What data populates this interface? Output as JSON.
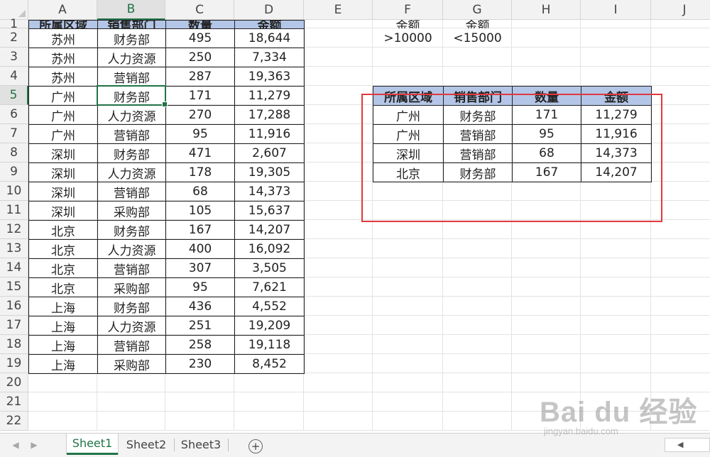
{
  "columns": [
    "A",
    "B",
    "C",
    "D",
    "E",
    "F",
    "G",
    "H",
    "I",
    "J"
  ],
  "rows": [
    "1",
    "2",
    "3",
    "4",
    "5",
    "6",
    "7",
    "8",
    "9",
    "10",
    "11",
    "12",
    "13",
    "14",
    "15",
    "16",
    "17",
    "18",
    "19",
    "20",
    "21",
    "22"
  ],
  "source_table": {
    "headers": [
      "所属区域",
      "销售部门",
      "数量",
      "金额"
    ],
    "rows": [
      [
        "苏州",
        "财务部",
        "495",
        "18,644"
      ],
      [
        "苏州",
        "人力资源",
        "250",
        "7,334"
      ],
      [
        "苏州",
        "营销部",
        "287",
        "19,363"
      ],
      [
        "广州",
        "财务部",
        "171",
        "11,279"
      ],
      [
        "广州",
        "人力资源",
        "270",
        "17,288"
      ],
      [
        "广州",
        "营销部",
        "95",
        "11,916"
      ],
      [
        "深圳",
        "财务部",
        "471",
        "2,607"
      ],
      [
        "深圳",
        "人力资源",
        "178",
        "19,305"
      ],
      [
        "深圳",
        "营销部",
        "68",
        "14,373"
      ],
      [
        "深圳",
        "采购部",
        "105",
        "15,637"
      ],
      [
        "北京",
        "财务部",
        "167",
        "14,207"
      ],
      [
        "北京",
        "人力资源",
        "400",
        "16,092"
      ],
      [
        "北京",
        "营销部",
        "307",
        "3,505"
      ],
      [
        "北京",
        "采购部",
        "95",
        "7,621"
      ],
      [
        "上海",
        "财务部",
        "436",
        "4,552"
      ],
      [
        "上海",
        "人力资源",
        "251",
        "19,209"
      ],
      [
        "上海",
        "营销部",
        "258",
        "19,118"
      ],
      [
        "上海",
        "采购部",
        "230",
        "8,452"
      ]
    ]
  },
  "criteria": {
    "headers": [
      "金额",
      "金额"
    ],
    "values": [
      ">10000",
      "<15000"
    ]
  },
  "result_table": {
    "headers": [
      "所属区域",
      "销售部门",
      "数量",
      "金额"
    ],
    "rows": [
      [
        "广州",
        "财务部",
        "171",
        "11,279"
      ],
      [
        "广州",
        "营销部",
        "95",
        "11,916"
      ],
      [
        "深圳",
        "营销部",
        "68",
        "14,373"
      ],
      [
        "北京",
        "财务部",
        "167",
        "14,207"
      ]
    ]
  },
  "active_cell": {
    "column": "B",
    "row": "5"
  },
  "sheet_tabs": [
    {
      "label": "Sheet1",
      "active": true
    },
    {
      "label": "Sheet2",
      "active": false
    },
    {
      "label": "Sheet3",
      "active": false
    }
  ],
  "add_sheet_symbol": "+",
  "nav_symbols": {
    "prev": "◀",
    "next": "▶",
    "scroll_left": "◀"
  },
  "watermark": {
    "main": "Bai du 经验",
    "sub": "jingyan.baidu.com"
  },
  "colors": {
    "header_fill": "#b4c6e7",
    "accent": "#217346",
    "highlight_box": "#e0393e"
  }
}
